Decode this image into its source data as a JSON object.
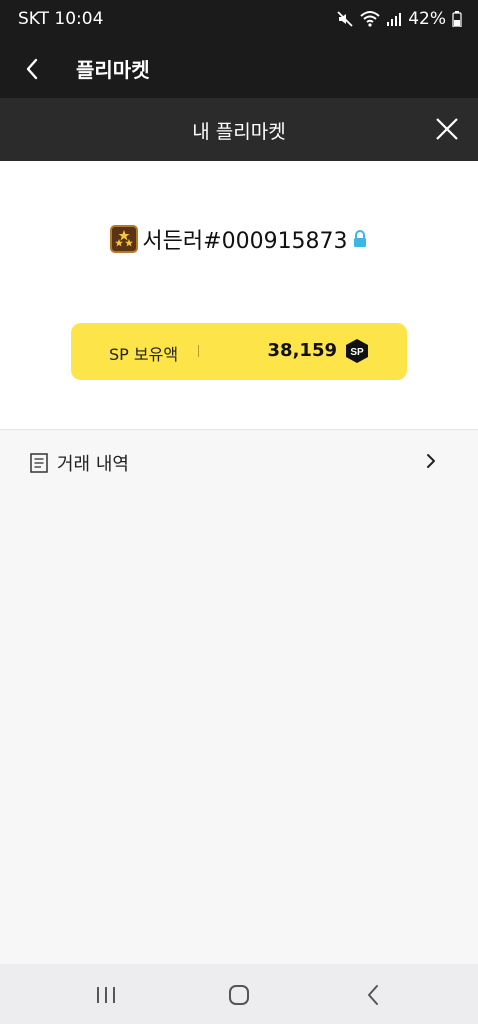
{
  "status_bar": {
    "carrier_time": "SKT 10:04",
    "battery": "42%",
    "icons": [
      "mute-icon",
      "wifi-icon",
      "signal-icon",
      "battery-icon"
    ]
  },
  "app_bar": {
    "title": "플리마켓",
    "back_icon": "back-arrow-icon"
  },
  "sub_header": {
    "title": "내 플리마켓",
    "close_icon": "close-icon"
  },
  "profile": {
    "nickname": "서든러#000915873",
    "badge_icon": "rank-stars-icon",
    "lock_icon": "lock-icon"
  },
  "sp_card": {
    "label": "SP 보유액",
    "amount": "38,159",
    "coin_icon": "sp-coin-icon",
    "coin_text": "SP"
  },
  "menu": {
    "history_label": "거래 내역",
    "history_icon": "document-icon",
    "chevron_icon": "chevron-right-icon"
  },
  "nav_bar": {
    "icons": [
      "recent-apps-icon",
      "home-icon",
      "back-icon"
    ]
  },
  "colors": {
    "dark_header": "#1b1b1b",
    "sub_header": "#2b2b2b",
    "accent_yellow": "#fde449",
    "lock_blue": "#3cb6e3"
  }
}
